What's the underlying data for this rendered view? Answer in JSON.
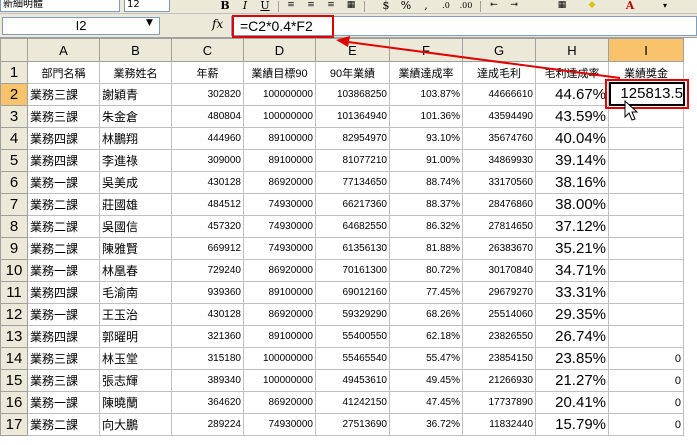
{
  "toolbar": {
    "font_name": "新細明體",
    "font_size": "12",
    "bold": "B",
    "italic": "I",
    "underline": "U",
    "currency": "$",
    "percent": "%",
    "comma": ","
  },
  "formula_bar": {
    "name_box": "I2",
    "fx": "fx",
    "formula": "=C2*0.4*F2"
  },
  "columns": [
    "A",
    "B",
    "C",
    "D",
    "E",
    "F",
    "G",
    "H",
    "I"
  ],
  "header_row": [
    "部門名稱",
    "業務姓名",
    "年薪",
    "業績目標90",
    "90年業績",
    "業績達成率",
    "達成毛利",
    "毛利達成率",
    "業績獎金"
  ],
  "rows": [
    {
      "n": "2",
      "dept": "業務三課",
      "name": "謝穎青",
      "salary": "302820",
      "target": "100000000",
      "actual": "103868250",
      "rate": "103.87%",
      "profit": "44666610",
      "prate": "44.67%",
      "bonus": "125813.5"
    },
    {
      "n": "3",
      "dept": "業務三課",
      "name": "朱金倉",
      "salary": "480804",
      "target": "100000000",
      "actual": "101364940",
      "rate": "101.36%",
      "profit": "43594490",
      "prate": "43.59%",
      "bonus": ""
    },
    {
      "n": "4",
      "dept": "業務四課",
      "name": "林鵬翔",
      "salary": "444960",
      "target": "89100000",
      "actual": "82954970",
      "rate": "93.10%",
      "profit": "35674760",
      "prate": "40.04%",
      "bonus": ""
    },
    {
      "n": "5",
      "dept": "業務四課",
      "name": "李進祿",
      "salary": "309000",
      "target": "89100000",
      "actual": "81077210",
      "rate": "91.00%",
      "profit": "34869930",
      "prate": "39.14%",
      "bonus": ""
    },
    {
      "n": "6",
      "dept": "業務一課",
      "name": "吳美成",
      "salary": "430128",
      "target": "86920000",
      "actual": "77134650",
      "rate": "88.74%",
      "profit": "33170560",
      "prate": "38.16%",
      "bonus": ""
    },
    {
      "n": "7",
      "dept": "業務二課",
      "name": "莊國雄",
      "salary": "484512",
      "target": "74930000",
      "actual": "66217360",
      "rate": "88.37%",
      "profit": "28476860",
      "prate": "38.00%",
      "bonus": ""
    },
    {
      "n": "8",
      "dept": "業務二課",
      "name": "吳國信",
      "salary": "457320",
      "target": "74930000",
      "actual": "64682550",
      "rate": "86.32%",
      "profit": "27814650",
      "prate": "37.12%",
      "bonus": ""
    },
    {
      "n": "9",
      "dept": "業務二課",
      "name": "陳雅賢",
      "salary": "669912",
      "target": "74930000",
      "actual": "61356130",
      "rate": "81.88%",
      "profit": "26383670",
      "prate": "35.21%",
      "bonus": ""
    },
    {
      "n": "10",
      "dept": "業務一課",
      "name": "林凰春",
      "salary": "729240",
      "target": "86920000",
      "actual": "70161300",
      "rate": "80.72%",
      "profit": "30170840",
      "prate": "34.71%",
      "bonus": ""
    },
    {
      "n": "11",
      "dept": "業務四課",
      "name": "毛渝南",
      "salary": "939360",
      "target": "89100000",
      "actual": "69012160",
      "rate": "77.45%",
      "profit": "29679270",
      "prate": "33.31%",
      "bonus": ""
    },
    {
      "n": "12",
      "dept": "業務一課",
      "name": "王玉治",
      "salary": "430128",
      "target": "86920000",
      "actual": "59329290",
      "rate": "68.26%",
      "profit": "25514060",
      "prate": "29.35%",
      "bonus": ""
    },
    {
      "n": "13",
      "dept": "業務四課",
      "name": "郭曜明",
      "salary": "321360",
      "target": "89100000",
      "actual": "55400550",
      "rate": "62.18%",
      "profit": "23826550",
      "prate": "26.74%",
      "bonus": ""
    },
    {
      "n": "14",
      "dept": "業務三課",
      "name": "林玉堂",
      "salary": "315180",
      "target": "100000000",
      "actual": "55465540",
      "rate": "55.47%",
      "profit": "23854150",
      "prate": "23.85%",
      "bonus": "0"
    },
    {
      "n": "15",
      "dept": "業務三課",
      "name": "張志輝",
      "salary": "389340",
      "target": "100000000",
      "actual": "49453610",
      "rate": "49.45%",
      "profit": "21266930",
      "prate": "21.27%",
      "bonus": "0"
    },
    {
      "n": "16",
      "dept": "業務一課",
      "name": "陳曉蘭",
      "salary": "364620",
      "target": "86920000",
      "actual": "41242150",
      "rate": "47.45%",
      "profit": "17737890",
      "prate": "20.41%",
      "bonus": "0"
    },
    {
      "n": "17",
      "dept": "業務二課",
      "name": "向大鵬",
      "salary": "289224",
      "target": "74930000",
      "actual": "27513690",
      "rate": "36.72%",
      "profit": "11832440",
      "prate": "15.79%",
      "bonus": "0"
    }
  ],
  "colors": {
    "highlight": "#e00000",
    "selected_header": "#f9c36b",
    "chrome": "#ece9d8"
  }
}
